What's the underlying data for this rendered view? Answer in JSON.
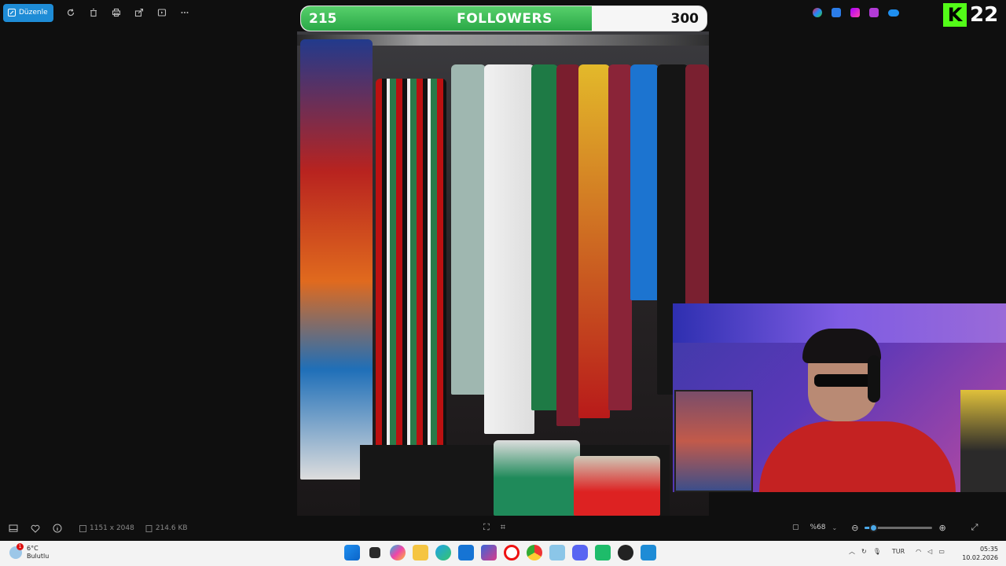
{
  "toolbar": {
    "edit_label": "Düzenle",
    "icons": [
      "rotate-icon",
      "delete-icon",
      "print-icon",
      "share-icon",
      "slideshow-icon",
      "more-icon"
    ]
  },
  "followers": {
    "current": "215",
    "label": "FOLLOWERS",
    "goal": "300",
    "progress": 0.7167,
    "fill_color": "#2aa847"
  },
  "kick": {
    "logo": "K",
    "count": "22",
    "color": "#53fc18"
  },
  "status": {
    "dimensions": "1151 x 2048",
    "size": "214.6 KB",
    "zoom": "%68",
    "zoom_fraction": 0.12,
    "accent": "#4aa8e8"
  },
  "taskbar": {
    "temp": "6°C",
    "weather": "Bulutlu",
    "badge": "1",
    "language": "TUR",
    "time": "05:35",
    "date": "10.02.2026"
  }
}
